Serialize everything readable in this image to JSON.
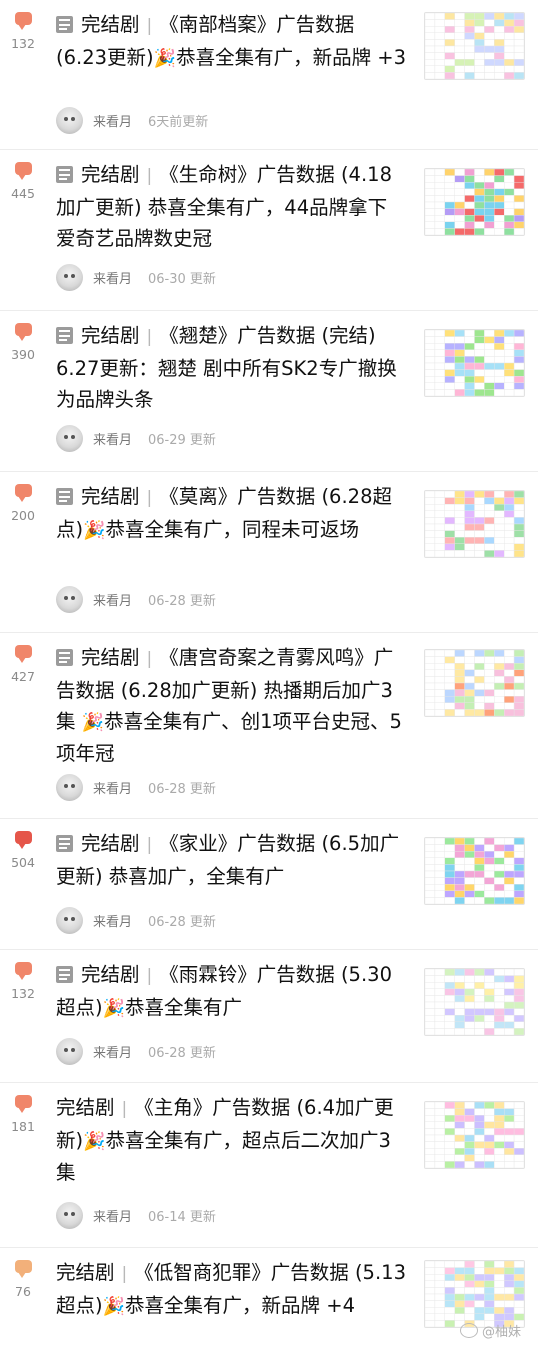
{
  "posts": [
    {
      "count": "132",
      "pre": "完结剧",
      "sep": "|",
      "text": "《南部档案》广告数据 (6.23更新)",
      "party": true,
      "text2": "恭喜全集有广，新品牌 +3",
      "author": "来看月",
      "time": "6天前更新",
      "bubble_color": "#f0866a"
    },
    {
      "count": "445",
      "pre": "完结剧",
      "sep": "|",
      "text": "《生命树》广告数据 (4.18加广更新) 恭喜全集有广，44品牌拿下爱奇艺品牌数史冠",
      "party": false,
      "text2": "",
      "author": "来看月",
      "time": "06-30 更新",
      "bubble_color": "#f0866a"
    },
    {
      "count": "390",
      "pre": "完结剧",
      "sep": "|",
      "text": "《翘楚》广告数据 (完结) 6.27更新：翘楚 剧中所有SK2专广撤换为品牌头条",
      "party": false,
      "text2": "",
      "author": "来看月",
      "time": "06-29 更新",
      "bubble_color": "#f0866a"
    },
    {
      "count": "200",
      "pre": "完结剧",
      "sep": "|",
      "text": "《莫离》广告数据 (6.28超点)",
      "party": true,
      "text2": "恭喜全集有广，同程未可返场",
      "author": "来看月",
      "time": "06-28 更新",
      "bubble_color": "#f0866a"
    },
    {
      "count": "427",
      "pre": "完结剧",
      "sep": "|",
      "text": "《唐宫奇案之青雾风鸣》广告数据 (6.28加广更新) 热播期后加广3集 ",
      "party": true,
      "text2": "恭喜全集有广、创1项平台史冠、5项年冠",
      "author": "来看月",
      "time": "06-28 更新",
      "bubble_color": "#f0866a"
    },
    {
      "count": "504",
      "pre": "完结剧",
      "sep": "|",
      "text": "《家业》广告数据 (6.5加广更新) 恭喜加广，全集有广",
      "party": false,
      "text2": "",
      "author": "来看月",
      "time": "06-28 更新",
      "bubble_color": "#e5564a"
    },
    {
      "count": "132",
      "pre": "完结剧",
      "sep": "|",
      "text": "《雨霖铃》广告数据 (5.30超点)",
      "party": true,
      "text2": "恭喜全集有广",
      "author": "来看月",
      "time": "06-28 更新",
      "bubble_color": "#f0866a"
    },
    {
      "count": "181",
      "pre": "完结剧",
      "sep": "|",
      "text": "《主角》广告数据 (6.4加广更新)",
      "party": true,
      "text2": "恭喜全集有广，超点后二次加广3集",
      "author": "来看月",
      "time": "06-14 更新",
      "bubble_color": "#f0866a"
    },
    {
      "count": "76",
      "pre": "完结剧",
      "sep": "|",
      "text": "《低智商犯罪》广告数据 (5.13超点)",
      "party": true,
      "text2": "恭喜全集有广，新品牌 +4",
      "author": "",
      "time": "",
      "bubble_color": "#f2b07a"
    }
  ],
  "watermark": "@柚妹",
  "icons": {
    "reply": "comment-bubble-icon",
    "doc": "document-icon",
    "party": "party-popper-icon"
  }
}
